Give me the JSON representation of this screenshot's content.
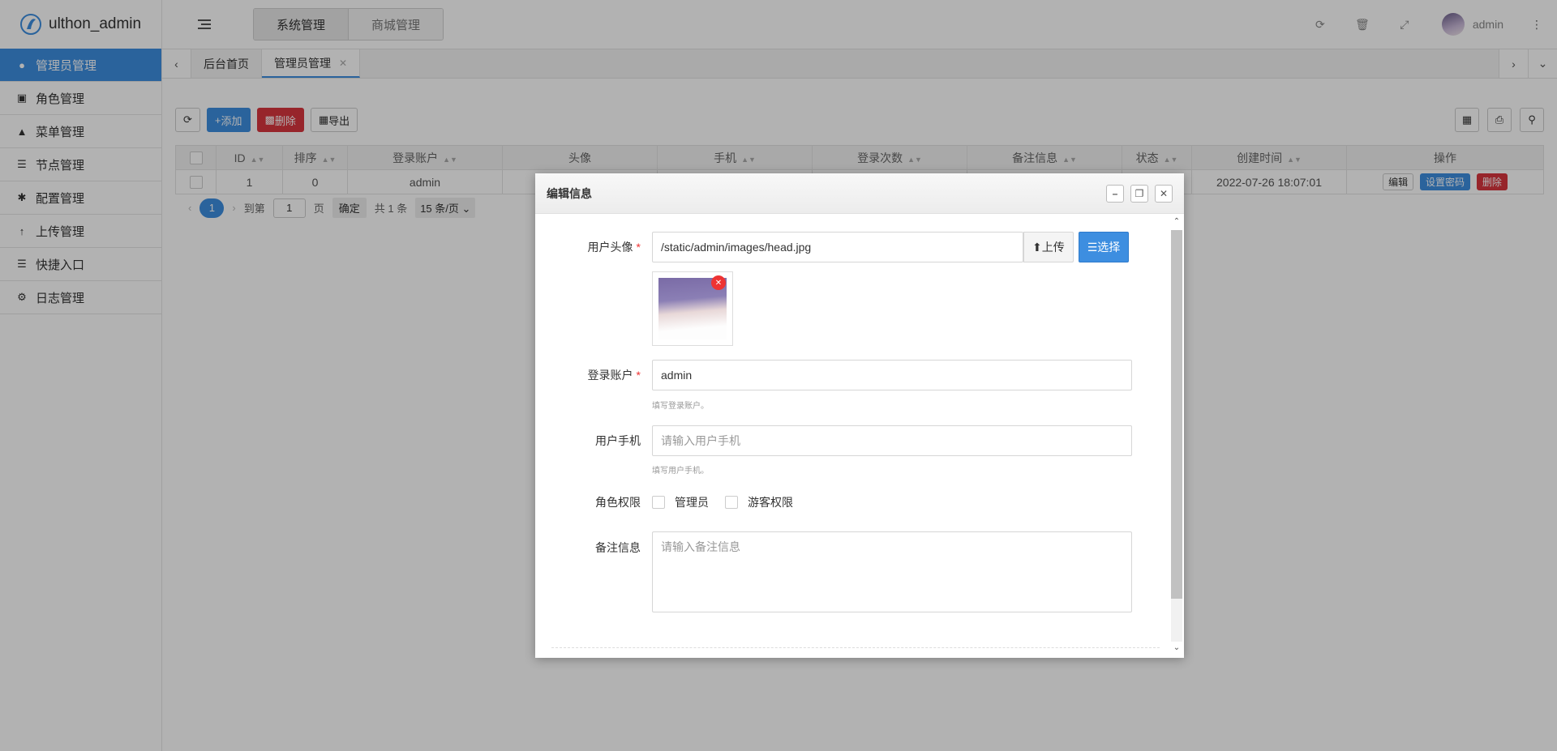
{
  "app": {
    "name": "ulthon_admin"
  },
  "sidebar": {
    "items": [
      {
        "label": "管理员管理",
        "icon": "user-icon",
        "active": true
      },
      {
        "label": "角色管理",
        "icon": "role-icon"
      },
      {
        "label": "菜单管理",
        "icon": "tree-icon"
      },
      {
        "label": "节点管理",
        "icon": "list-icon"
      },
      {
        "label": "配置管理",
        "icon": "asterisk-icon"
      },
      {
        "label": "上传管理",
        "icon": "arrow-up-icon"
      },
      {
        "label": "快捷入口",
        "icon": "list-icon"
      },
      {
        "label": "日志管理",
        "icon": "gears-icon"
      }
    ]
  },
  "header": {
    "tabs": [
      "系统管理",
      "商城管理"
    ],
    "user": "admin"
  },
  "tabbar": {
    "tabs": [
      "后台首页",
      "管理员管理"
    ]
  },
  "toolbar": {
    "add": "添加",
    "delete": "删除",
    "export": "导出"
  },
  "table": {
    "columns": [
      "ID",
      "排序",
      "登录账户",
      "头像",
      "手机",
      "登录次数",
      "备注信息",
      "状态",
      "创建时间",
      "操作"
    ],
    "rows": [
      {
        "id": "1",
        "sort": "0",
        "account": "admin",
        "created": "2022-07-26 18:07:01"
      }
    ],
    "actions": {
      "edit": "编辑",
      "set_password": "设置密码",
      "delete": "删除"
    }
  },
  "pager": {
    "current": "1",
    "goto_label": "到第",
    "page_input": "1",
    "page_unit": "页",
    "confirm": "确定",
    "total": "共 1 条",
    "per_page": "15 条/页"
  },
  "modal": {
    "title": "编辑信息",
    "avatar_label": "用户头像",
    "avatar_value": "/static/admin/images/head.jpg",
    "upload_btn": "上传",
    "choose_btn": "选择",
    "account_label": "登录账户",
    "account_value": "admin",
    "account_hint": "填写登录账户。",
    "phone_label": "用户手机",
    "phone_placeholder": "请输入用户手机",
    "phone_hint": "填写用户手机。",
    "role_label": "角色权限",
    "roles": [
      "管理员",
      "游客权限"
    ],
    "remark_label": "备注信息",
    "remark_placeholder": "请输入备注信息"
  }
}
